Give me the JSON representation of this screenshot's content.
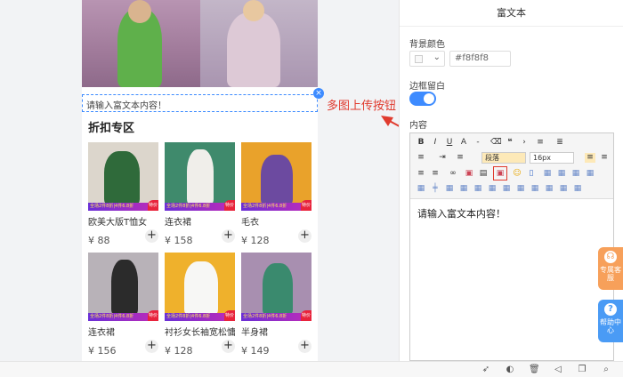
{
  "preview": {
    "rich_text_placeholder": "请输入富文本内容！",
    "close_icon": "×",
    "section_title": "折扣专区",
    "goods": [
      {
        "name": "欧美大版T恤女",
        "price": "88",
        "promo": "全场2件8折|4件6.8折",
        "badge": "特价"
      },
      {
        "name": "连衣裙",
        "price": "158",
        "promo": "全场2件8折|4件6.8折",
        "badge": "特价"
      },
      {
        "name": "毛衣",
        "price": "128",
        "promo": "全场2件8折|4件6.8折",
        "badge": "特价"
      },
      {
        "name": "连衣裙",
        "price": "156",
        "promo": "全场2件8折|4件6.8折",
        "badge": "特价"
      },
      {
        "name": "衬衫女长袖宽松慵懒",
        "price": "128",
        "promo": "全场2件8折|4件6.8折",
        "badge": "特价"
      },
      {
        "name": "半身裙",
        "price": "149",
        "promo": "全场2件8折|4件6.8折",
        "badge": "特价"
      }
    ],
    "currency": "¥",
    "add_icon": "+"
  },
  "panel": {
    "title": "富文本",
    "bg_color_label": "背景颜色",
    "bg_color_value": "#f8f8f8",
    "border_label": "边框留白",
    "border_enabled": true,
    "content_label": "内容",
    "editor_text": "请输入富文本内容！",
    "toolbar": {
      "paragraph": "段落",
      "font_size": "16px"
    }
  },
  "annotation": {
    "text": "多图上传按钮",
    "color": "#e03b2e"
  },
  "float_buttons": [
    {
      "label": "专属客服",
      "color": "#f7a05a",
      "icon": "headset-icon"
    },
    {
      "label": "帮助中心",
      "color": "#4a9bf5",
      "icon": "help-icon"
    }
  ],
  "colors": {
    "accent": "#3d8bff"
  }
}
